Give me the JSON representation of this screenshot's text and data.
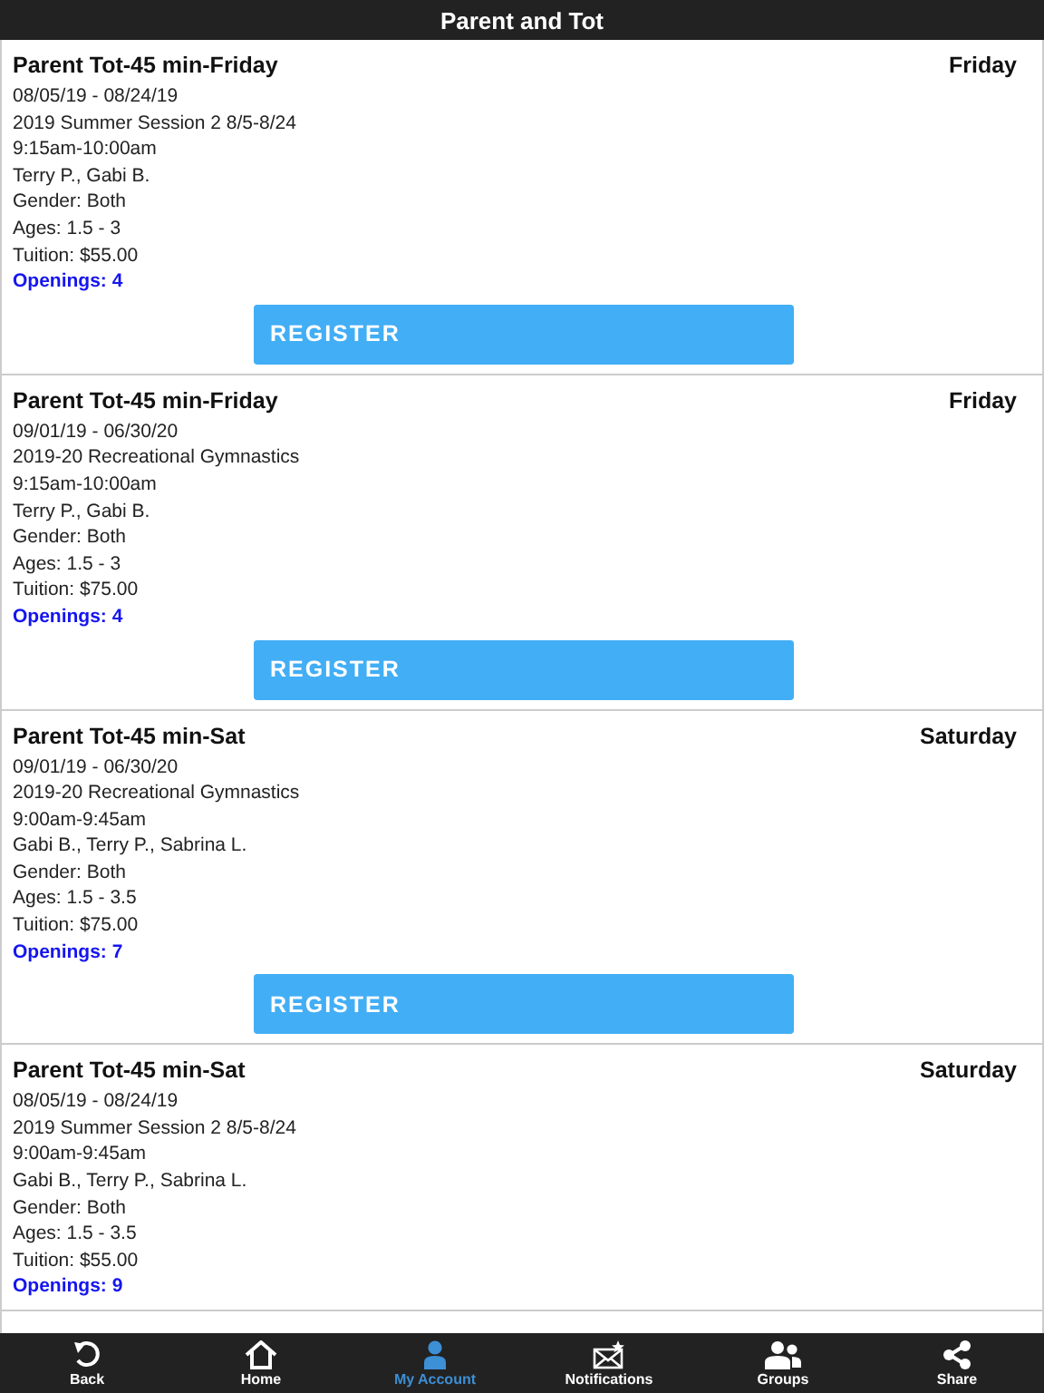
{
  "header": {
    "title": "Parent and Tot"
  },
  "classes": [
    {
      "name": "Parent Tot-45 min-Friday",
      "day": "Friday",
      "lines": [
        "08/05/19 - 08/24/19",
        "2019 Summer Session 2 8/5-8/24",
        "9:15am-10:00am",
        "Terry P., Gabi B.",
        "Gender: Both",
        "Ages: 1.5 - 3",
        "Tuition: $55.00"
      ],
      "openings": "Openings: 4",
      "button": "REGISTER"
    },
    {
      "name": "Parent Tot-45 min-Friday",
      "day": "Friday",
      "lines": [
        "09/01/19 - 06/30/20",
        "2019-20 Recreational Gymnastics",
        "9:15am-10:00am",
        "Terry P., Gabi B.",
        "Gender: Both",
        "Ages: 1.5 - 3",
        "Tuition: $75.00"
      ],
      "openings": "Openings: 4",
      "button": "REGISTER"
    },
    {
      "name": "Parent Tot-45 min-Sat",
      "day": "Saturday",
      "lines": [
        "09/01/19 - 06/30/20",
        "2019-20 Recreational Gymnastics",
        "9:00am-9:45am",
        "Gabi B., Terry P., Sabrina L.",
        "Gender: Both",
        "Ages: 1.5 - 3.5",
        "Tuition: $75.00"
      ],
      "openings": "Openings: 7",
      "button": "REGISTER"
    },
    {
      "name": "Parent Tot-45 min-Sat",
      "day": "Saturday",
      "lines": [
        "08/05/19 - 08/24/19",
        "2019 Summer Session 2 8/5-8/24",
        "9:00am-9:45am",
        "Gabi B., Terry P., Sabrina L.",
        "Gender: Both",
        "Ages: 1.5 - 3.5",
        "Tuition: $55.00"
      ],
      "openings": "Openings: 9"
    }
  ],
  "nav": [
    {
      "kind": "back",
      "label": "Back",
      "selected": false
    },
    {
      "kind": "home",
      "label": "Home",
      "selected": false
    },
    {
      "kind": "account",
      "label": "My Account",
      "selected": true
    },
    {
      "kind": "notifications",
      "label": "Notifications",
      "selected": false
    },
    {
      "kind": "groups",
      "label": "Groups",
      "selected": false
    },
    {
      "kind": "share",
      "label": "Share",
      "selected": false
    }
  ]
}
